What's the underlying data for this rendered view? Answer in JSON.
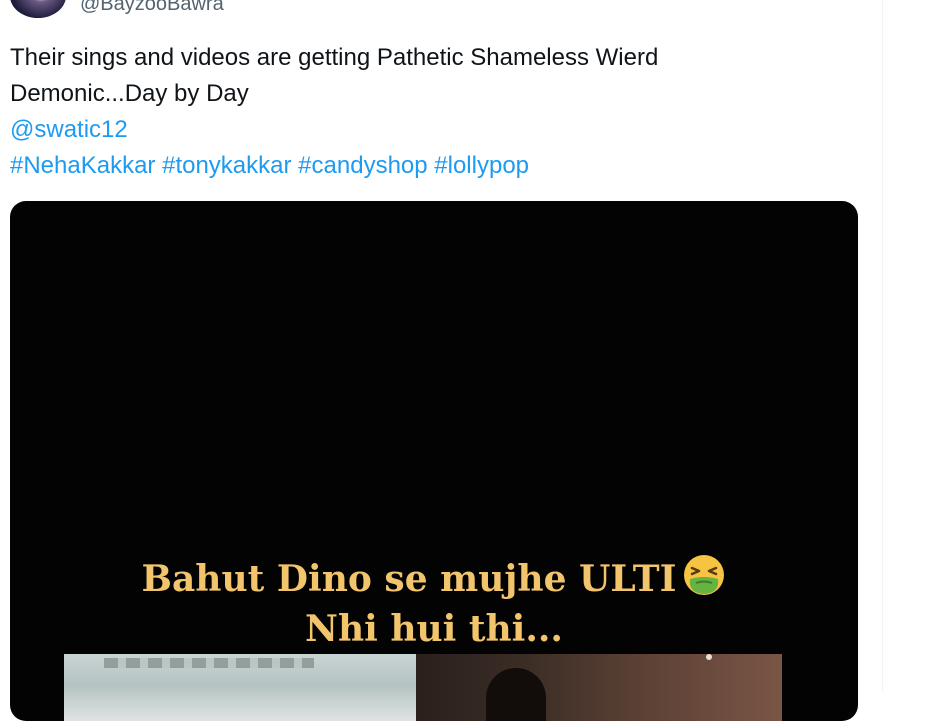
{
  "tweet": {
    "handle": "@BayzooBawra",
    "text_line1": "Their sings and videos are getting Pathetic Shameless Wierd",
    "text_line2": "Demonic...Day by Day",
    "mention": "@swatic12",
    "hashtags": [
      "#NehaKakkar",
      "#tonykakkar",
      "#candyshop",
      "#lollypop"
    ]
  },
  "media": {
    "caption_line1": "Bahut Dino se mujhe ULTI",
    "caption_line2": "Nhi hui thi...",
    "emoji": "nauseated-face-icon"
  },
  "colors": {
    "link": "#1d9bf0",
    "text": "#0f1419",
    "handle": "#536471",
    "caption": "#f2c46c",
    "media_bg": "#030303"
  }
}
